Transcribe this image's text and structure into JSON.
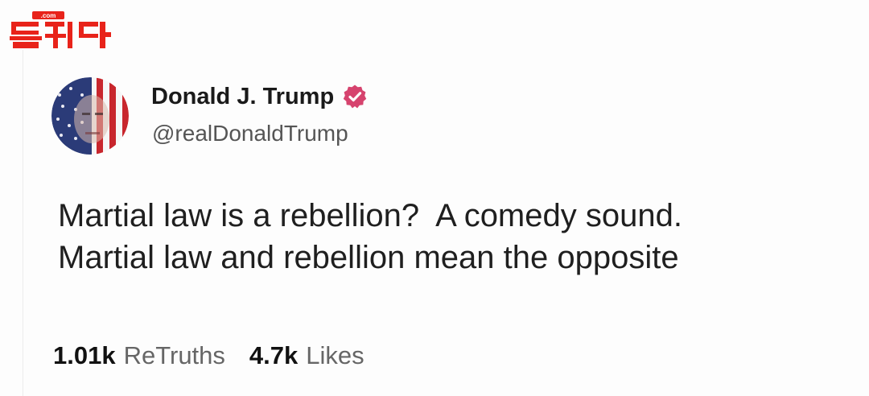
{
  "watermark": {
    "domain_text": ".com",
    "logo_icon": "site-logo-korean-red"
  },
  "post": {
    "author": {
      "display_name": "Donald J. Trump",
      "handle": "@realDonaldTrump",
      "verified": true,
      "verified_icon": "verified-badge-icon",
      "avatar_icon": "avatar-flag-portrait"
    },
    "text_lines": [
      "Martial law is a rebellion?  A comedy sound.",
      "Martial law and rebellion mean the opposite"
    ],
    "stats": {
      "retruths_count": "1.01k",
      "retruths_label": "ReTruths",
      "likes_count": "4.7k",
      "likes_label": "Likes"
    }
  },
  "colors": {
    "verified_badge": "#d6436e",
    "logo_red": "#e8231a",
    "text_primary": "#1a1a1a",
    "text_secondary": "#555555"
  }
}
